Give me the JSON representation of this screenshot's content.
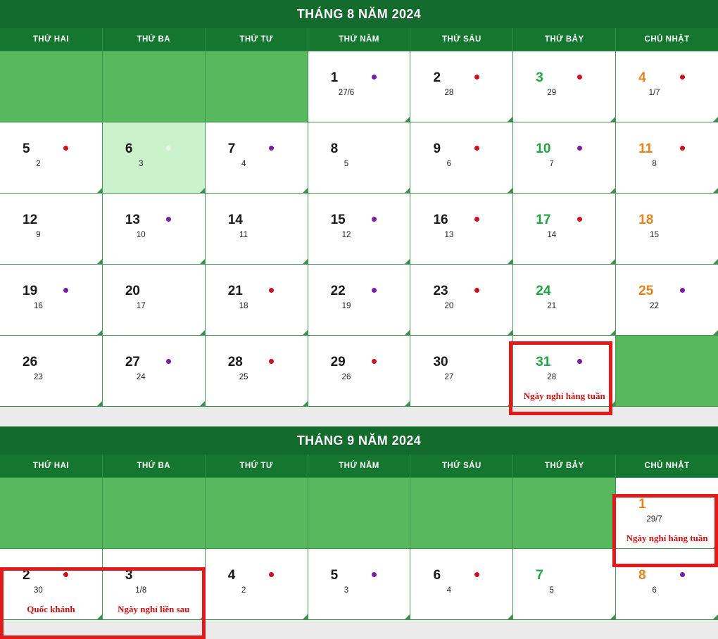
{
  "colors": {
    "header_dark_green": "#146b2e",
    "dow_green": "#15772f",
    "empty_cell_green": "#57b85e",
    "today_green": "#ccf2cc",
    "saturday": "#22a444",
    "sunday": "#e8821a",
    "holiday_text_red": "#cc1111",
    "box_red": "#e01b1b",
    "dot_red": "#cc1122",
    "dot_purple": "#7a1fa2",
    "page_gap": "#ebebeb"
  },
  "weekday_headers": [
    "THỨ HAI",
    "THỨ BA",
    "THỨ TƯ",
    "THỨ NĂM",
    "THỨ SÁU",
    "THỨ BẢY",
    "CHỦ NHẬT"
  ],
  "months": [
    {
      "title": "THÁNG 8 NĂM 2024",
      "weeks": [
        [
          {
            "empty": true
          },
          {
            "empty": true
          },
          {
            "empty": true
          },
          {
            "day": "1",
            "lunar": "27/6",
            "dot": "purple",
            "kind": "weekday"
          },
          {
            "day": "2",
            "lunar": "28",
            "dot": "red",
            "kind": "weekday"
          },
          {
            "day": "3",
            "lunar": "29",
            "dot": "red",
            "kind": "sat"
          },
          {
            "day": "4",
            "lunar": "1/7",
            "dot": "red",
            "kind": "sun"
          }
        ],
        [
          {
            "day": "5",
            "lunar": "2",
            "dot": "red",
            "kind": "weekday"
          },
          {
            "day": "6",
            "lunar": "3",
            "dot": "white",
            "kind": "weekday",
            "today": true
          },
          {
            "day": "7",
            "lunar": "4",
            "dot": "purple",
            "kind": "weekday"
          },
          {
            "day": "8",
            "lunar": "5",
            "dot": "none",
            "kind": "weekday"
          },
          {
            "day": "9",
            "lunar": "6",
            "dot": "red",
            "kind": "weekday"
          },
          {
            "day": "10",
            "lunar": "7",
            "dot": "purple",
            "kind": "sat"
          },
          {
            "day": "11",
            "lunar": "8",
            "dot": "red",
            "kind": "sun"
          }
        ],
        [
          {
            "day": "12",
            "lunar": "9",
            "dot": "none",
            "kind": "weekday"
          },
          {
            "day": "13",
            "lunar": "10",
            "dot": "purple",
            "kind": "weekday"
          },
          {
            "day": "14",
            "lunar": "11",
            "dot": "none",
            "kind": "weekday"
          },
          {
            "day": "15",
            "lunar": "12",
            "dot": "purple",
            "kind": "weekday"
          },
          {
            "day": "16",
            "lunar": "13",
            "dot": "red",
            "kind": "weekday"
          },
          {
            "day": "17",
            "lunar": "14",
            "dot": "red",
            "kind": "sat"
          },
          {
            "day": "18",
            "lunar": "15",
            "dot": "none",
            "kind": "sun"
          }
        ],
        [
          {
            "day": "19",
            "lunar": "16",
            "dot": "purple",
            "kind": "weekday"
          },
          {
            "day": "20",
            "lunar": "17",
            "dot": "none",
            "kind": "weekday"
          },
          {
            "day": "21",
            "lunar": "18",
            "dot": "red",
            "kind": "weekday"
          },
          {
            "day": "22",
            "lunar": "19",
            "dot": "purple",
            "kind": "weekday"
          },
          {
            "day": "23",
            "lunar": "20",
            "dot": "red",
            "kind": "weekday"
          },
          {
            "day": "24",
            "lunar": "21",
            "dot": "none",
            "kind": "sat"
          },
          {
            "day": "25",
            "lunar": "22",
            "dot": "purple",
            "kind": "sun"
          }
        ],
        [
          {
            "day": "26",
            "lunar": "23",
            "dot": "none",
            "kind": "weekday"
          },
          {
            "day": "27",
            "lunar": "24",
            "dot": "purple",
            "kind": "weekday"
          },
          {
            "day": "28",
            "lunar": "25",
            "dot": "red",
            "kind": "weekday"
          },
          {
            "day": "29",
            "lunar": "26",
            "dot": "red",
            "kind": "weekday"
          },
          {
            "day": "30",
            "lunar": "27",
            "dot": "none",
            "kind": "weekday"
          },
          {
            "day": "31",
            "lunar": "28",
            "dot": "purple",
            "kind": "sat",
            "note": "Ngày nghỉ hàng tuần"
          },
          {
            "empty": true
          }
        ]
      ]
    },
    {
      "title": "THÁNG 9 NĂM 2024",
      "weeks": [
        [
          {
            "empty": true
          },
          {
            "empty": true
          },
          {
            "empty": true
          },
          {
            "empty": true
          },
          {
            "empty": true
          },
          {
            "empty": true
          },
          {
            "day": "1",
            "lunar": "29/7",
            "dot": "none",
            "kind": "sun",
            "note": "Ngày nghỉ hàng tuần"
          }
        ],
        [
          {
            "day": "2",
            "lunar": "30",
            "dot": "red",
            "kind": "weekday",
            "note": "Quốc khánh"
          },
          {
            "day": "3",
            "lunar": "1/8",
            "dot": "none",
            "kind": "weekday",
            "note": "Ngày nghỉ liền sau"
          },
          {
            "day": "4",
            "lunar": "2",
            "dot": "red",
            "kind": "weekday"
          },
          {
            "day": "5",
            "lunar": "3",
            "dot": "purple",
            "kind": "weekday"
          },
          {
            "day": "6",
            "lunar": "4",
            "dot": "red",
            "kind": "weekday"
          },
          {
            "day": "7",
            "lunar": "5",
            "dot": "none",
            "kind": "sat"
          },
          {
            "day": "8",
            "lunar": "6",
            "dot": "purple",
            "kind": "sun"
          }
        ]
      ]
    }
  ]
}
